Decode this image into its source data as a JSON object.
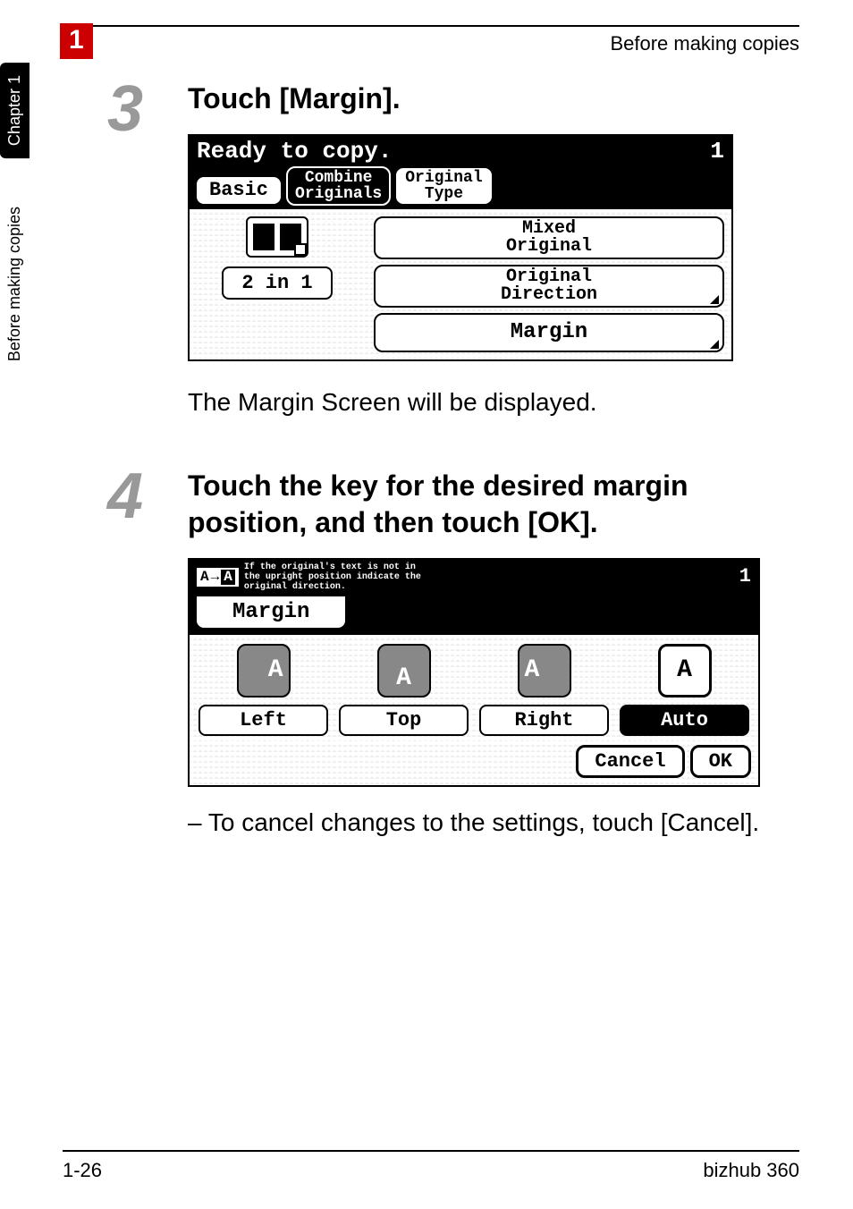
{
  "header": {
    "chapter_number": "1",
    "title_right": "Before making copies"
  },
  "side_tabs": {
    "chapter": "Chapter 1",
    "section": "Before making copies"
  },
  "steps": {
    "s3": {
      "number": "3",
      "title": "Touch [Margin].",
      "after_text": "The Margin Screen will be displayed."
    },
    "s4": {
      "number": "4",
      "title": "Touch the key for the desired margin position, and then touch [OK].",
      "sub": "– To cancel changes to the settings, touch [Cancel]."
    }
  },
  "screen1": {
    "status": "Ready to copy.",
    "count": "1",
    "tabs": {
      "basic": "Basic",
      "combine_l1": "Combine",
      "combine_l2": "Originals",
      "orig_l1": "Original",
      "orig_l2": "Type"
    },
    "left_label": "2 in 1",
    "options": {
      "mixed_l1": "Mixed",
      "mixed_l2": "Original",
      "dir_l1": "Original",
      "dir_l2": "Direction",
      "margin": "Margin"
    }
  },
  "screen2": {
    "hint_l1": "If the original's text is not in",
    "hint_l2": "the upright position indicate the",
    "hint_l3": "original direction.",
    "count": "1",
    "tab": "Margin",
    "options": {
      "left": "Left",
      "top": "Top",
      "right": "Right",
      "auto": "Auto"
    },
    "footer": {
      "cancel": "Cancel",
      "ok": "OK"
    }
  },
  "footer": {
    "left": "1-26",
    "right": "bizhub 360"
  }
}
